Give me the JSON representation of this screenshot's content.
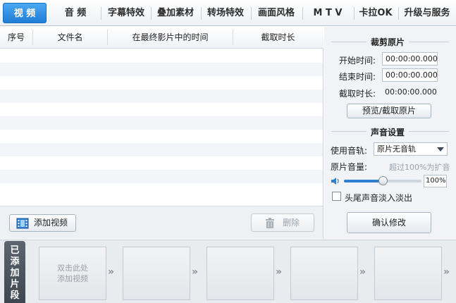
{
  "tabs": [
    "视 频",
    "音 频",
    "字幕特效",
    "叠加素材",
    "转场特效",
    "画面风格",
    "M T V",
    "卡拉OK",
    "升级与服务"
  ],
  "active_tab": 0,
  "table": {
    "columns": [
      "序号",
      "文件名",
      "在最终影片中的时间",
      "截取时长"
    ],
    "rows": []
  },
  "left_buttons": {
    "add_video": "添加视频",
    "delete": "删除"
  },
  "trim": {
    "title": "裁剪原片",
    "start_label": "开始时间:",
    "start_value": "00:00:00.000",
    "end_label": "结束时间:",
    "end_value": "00:00:00.000",
    "duration_label": "截取时长:",
    "duration_value": "00:00:00.000",
    "preview_button": "预览/截取原片"
  },
  "audio": {
    "title": "声音设置",
    "track_label": "使用音轨:",
    "track_value": "原片无音轨",
    "volume_label": "原片音量:",
    "volume_hint": "超过100%为扩音",
    "volume_value": "100%",
    "volume_level": 0.5,
    "fade_label": "头尾声音淡入淡出",
    "fade_checked": false,
    "confirm_button": "确认修改"
  },
  "strip": {
    "label": "已添加片段",
    "first_clip_text": "双击此处\n添加视频",
    "arrow": "»"
  },
  "colors": {
    "accent": "#1f7ed6",
    "strip_label_bg": "#4b535c"
  }
}
